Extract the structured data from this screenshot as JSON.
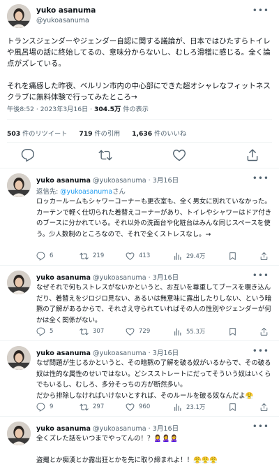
{
  "author": {
    "name": "yuko asanuma",
    "handle": "@yukoasanuma"
  },
  "main_tweet": {
    "text": "トランスジェンダーやジェンダー自認に関する議論が、日本ではひたすらトイレや風呂場の話に終始してるの、意味分からないし、むしろ滑稽に感じる。全く論点がズレている。\n\nそれを痛感した昨夜、ベルリン市内の中心部にできた超オシャレなフィットネスクラブに無料体験で行ってみたところ→",
    "time": "午後8:52 · 2023年3月16日",
    "views_count": "304.5万",
    "views_label": "件の表示",
    "retweets_count": "503",
    "retweets_label": "件のリツイート",
    "quotes_count": "719",
    "quotes_label": "件の引用",
    "likes_count": "1,636",
    "likes_label": "件のいいね"
  },
  "replies": [
    {
      "name": "yuko asanuma",
      "handle": "@yukoasanuma",
      "date": "· 3月16日",
      "reply_to_prefix": "返信先: ",
      "reply_to_mention": "@yukoasanuma",
      "reply_to_suffix": "さん",
      "text": "ロッカールームもシャワーコーナーも更衣室も、全く男女に別れていなかった。カーテンで軽く仕切られた着替えコーナーがあり、トイレやシャワーはドア付きのブースに分かれている。それ以外の洗面台や化粧台はみんな同じスペースを使う。少人数制のところなので、それで全くストレスなし。→",
      "replies": "6",
      "retweets": "219",
      "likes": "413",
      "views": "29.4万"
    },
    {
      "name": "yuko asanuma",
      "handle": "@yukoasanuma",
      "date": "· 3月16日",
      "text": "なぜそれで何もストレスがないかというと、お互いを尊重してブースを覗き込んだり、着替えをジロジロ見ない、あるいは無意味に露出したりしない、という暗黙の了解があるからで、それさえ守られていればその人の性別やジェンダーが何かは全く関係がない。",
      "replies": "5",
      "retweets": "307",
      "likes": "729",
      "views": "55.3万"
    },
    {
      "name": "yuko asanuma",
      "handle": "@yukoasanuma",
      "date": "· 3月16日",
      "text": "なぜ問題が生じるかというと、その暗黙の了解を破る奴がいるからで、その破る奴は性的な属性のせいではない。どシスストレートにだってそういう奴はいくらでもいるし、むしろ、多分そっちの方が断然多い。\nだから排除しなければいけないとすれば、そのルールを破る奴なんだよ😤",
      "replies": "9",
      "retweets": "297",
      "likes": "960",
      "views": "23.1万"
    },
    {
      "name": "yuko asanuma",
      "handle": "@yukoasanuma",
      "date": "· 3月16日",
      "text": "全くズレた話をいつまでやってんの！？🙎‍♀️🙎‍♀️🙎‍♀️\n\n盗撮とか痴漢とか露出狂とかを先に取り締まれよ！！😤😤😤"
    }
  ],
  "icons": [
    "more-icon",
    "reply-icon",
    "retweet-icon",
    "like-icon",
    "bookmark-icon",
    "share-icon",
    "views-icon"
  ],
  "colors": {
    "text": "#0f1419",
    "secondary": "#536471",
    "link": "#1d9bf0",
    "divider": "#eff3f4"
  }
}
